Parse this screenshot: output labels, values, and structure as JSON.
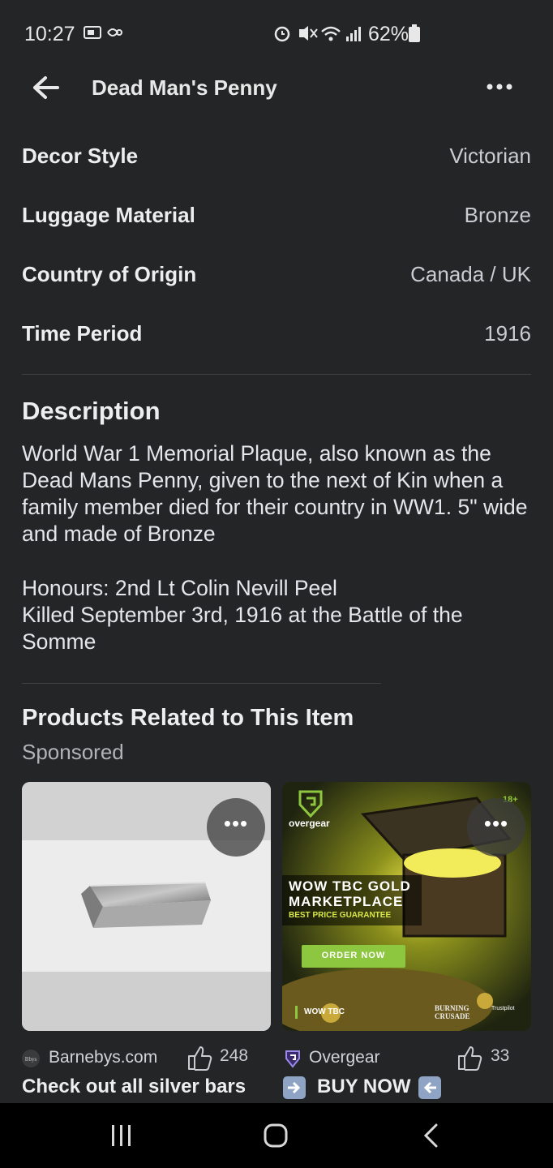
{
  "status_bar": {
    "time": "10:27",
    "battery": "62%"
  },
  "header": {
    "title": "Dead Man's Penny"
  },
  "specs": [
    {
      "key": "Decor Style",
      "value": "Victorian"
    },
    {
      "key": "Luggage Material",
      "value": "Bronze"
    },
    {
      "key": "Country of Origin",
      "value": "Canada / UK"
    },
    {
      "key": "Time Period",
      "value": "1916"
    }
  ],
  "description": {
    "heading": "Description",
    "paragraph1": "World War 1 Memorial Plaque, also known as the Dead Mans Penny, given to the next of Kin when a family member died for their country in WW1. 5\" wide and made of Bronze",
    "paragraph2_line1": "Honours: 2nd Lt Colin Nevill Peel",
    "paragraph2_line2": "Killed September 3rd, 1916 at the Battle of the Somme"
  },
  "related": {
    "heading": "Products Related to This Item",
    "sponsored_label": "Sponsored",
    "products": [
      {
        "seller": "Barnebys.com",
        "seller_logo_text": "Bbys",
        "likes": "248",
        "cta": "Check out all silver bars"
      },
      {
        "seller": "Overgear",
        "likes": "33",
        "cta": "BUY NOW",
        "ad": {
          "age_badge": "18+",
          "brand": "overgear",
          "headline_line1": "WOW TBC GOLD",
          "headline_line2": "MARKETPLACE",
          "tagline": "BEST PRICE GUARANTEE",
          "button": "ORDER NOW",
          "footer_left": "WOW TBC",
          "footer_logo_line1": "BURNING",
          "footer_logo_line2": "CRUSADE",
          "trustpilot": "Trustpilot"
        }
      }
    ]
  },
  "colors": {
    "background": "#242526",
    "accent_green": "#8dc63f"
  },
  "icons": [
    "back-arrow-icon",
    "more-options-icon",
    "thumbs-up-icon",
    "recents-icon",
    "home-icon",
    "back-nav-icon"
  ]
}
